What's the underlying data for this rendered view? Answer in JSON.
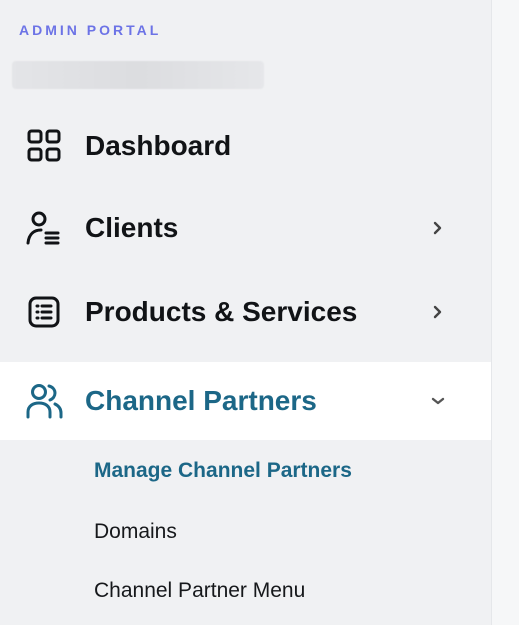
{
  "header": {
    "portal_label": "ADMIN PORTAL"
  },
  "nav": [
    {
      "label": "Dashboard",
      "icon": "dashboard-grid-icon",
      "has_chevron": false
    },
    {
      "label": "Clients",
      "icon": "clients-user-list-icon",
      "has_chevron": true,
      "chevron": "chevron-right-icon"
    },
    {
      "label": "Products & Services",
      "icon": "products-list-icon",
      "has_chevron": true,
      "chevron": "chevron-right-icon"
    },
    {
      "label": "Channel Partners",
      "icon": "channel-partners-users-icon",
      "has_chevron": true,
      "chevron": "chevron-down-icon",
      "active": true
    }
  ],
  "submenu": [
    {
      "label": "Manage Channel Partners",
      "active": true
    },
    {
      "label": "Domains"
    },
    {
      "label": "Channel Partner Menu"
    }
  ],
  "colors": {
    "accent": "#1c6787",
    "portal_label": "#6c73e6",
    "text": "#111316",
    "background": "#f0f1f3",
    "active_background": "#ffffff"
  }
}
